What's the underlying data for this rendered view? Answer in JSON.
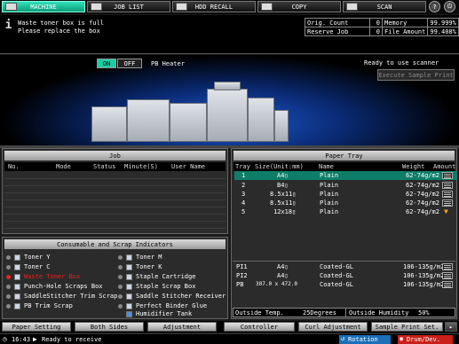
{
  "topbar": {
    "machine": "MACHINE",
    "job_list": "JOB LIST",
    "hdd_recall": "HDD RECALL",
    "copy": "COPY",
    "scan": "SCAN"
  },
  "message": {
    "line1": "Waste toner box is full",
    "line2": "Please replace the box"
  },
  "counters": {
    "orig_count_label": "Orig. Count",
    "orig_count_value": "0",
    "reserve_job_label": "Reserve Job",
    "reserve_job_value": "0",
    "memory_label": "Memory",
    "memory_value": "99.999%",
    "file_amount_label": "File Amount",
    "file_amount_value": "99.408%"
  },
  "pb_heater": {
    "on": "ON",
    "off": "OFF",
    "label": "PB Heater"
  },
  "scanner_status": "Ready to use scanner",
  "execute_sample_print": "Execute Sample Print",
  "job_panel": {
    "title": "Job",
    "columns": [
      "No.",
      "Mode",
      "Status",
      "Minute(S)",
      "User Name"
    ]
  },
  "paper_tray": {
    "title": "Paper Tray",
    "columns": [
      "Tray",
      "Size(Unit:mm)",
      "Name",
      "Weight",
      "Amount"
    ],
    "rows": [
      {
        "tray": "1",
        "size": "A4▯",
        "name": "Plain",
        "weight": "62-74g/m2"
      },
      {
        "tray": "2",
        "size": "B4▯",
        "name": "Plain",
        "weight": "62-74g/m2"
      },
      {
        "tray": "3",
        "size": "8.5x11▯",
        "name": "Plain",
        "weight": "62-74g/m2"
      },
      {
        "tray": "4",
        "size": "8.5x11▯",
        "name": "Plain",
        "weight": "62-74g/m2"
      },
      {
        "tray": "5",
        "size": "12x18▯",
        "name": "Plain",
        "weight": "62-74g/m2"
      }
    ],
    "extra_rows": [
      {
        "tray": "PI1",
        "size": "A4▯",
        "name": "Coated-GL",
        "weight": "106-135g/m2"
      },
      {
        "tray": "PI2",
        "size": "A4▯",
        "name": "Coated-GL",
        "weight": "106-135g/m2"
      },
      {
        "tray": "PB",
        "size": "307.0 x 472.0",
        "name": "Coated-GL",
        "weight": "106-135g/m2"
      }
    ],
    "outside_temp_label": "Outside Temp.",
    "outside_temp_value": "25Degrees",
    "outside_humidity_label": "Outside Humidity",
    "outside_humidity_value": "50%"
  },
  "consumables": {
    "title": "Consumable and Scrap Indicators",
    "left": [
      "Toner Y",
      "Toner C",
      "Waste Toner Box",
      "Punch-Hole Scraps Box",
      "SaddleStitcher Trim Scrap",
      "PB Trim Scrap"
    ],
    "right": [
      "Toner M",
      "Toner K",
      "Staple Cartridge",
      "Staple Scrap Box",
      "Saddle Stitcher Receiver",
      "Perfect Binder Glue",
      "Humidifier Tank"
    ],
    "alert_color": "#e3251c"
  },
  "bottom_tabs": [
    "Paper Setting",
    "Both Sides",
    "Adjustment",
    "Controller",
    "Curl Adjustment",
    "Sample Print Set."
  ],
  "status": {
    "time": "16:43",
    "text": "Ready to receive",
    "rotation": "Rotation",
    "drum": "Drum/Dev."
  },
  "colors": {
    "accent": "#1dcca4",
    "selected_row": "#0e7e68"
  }
}
